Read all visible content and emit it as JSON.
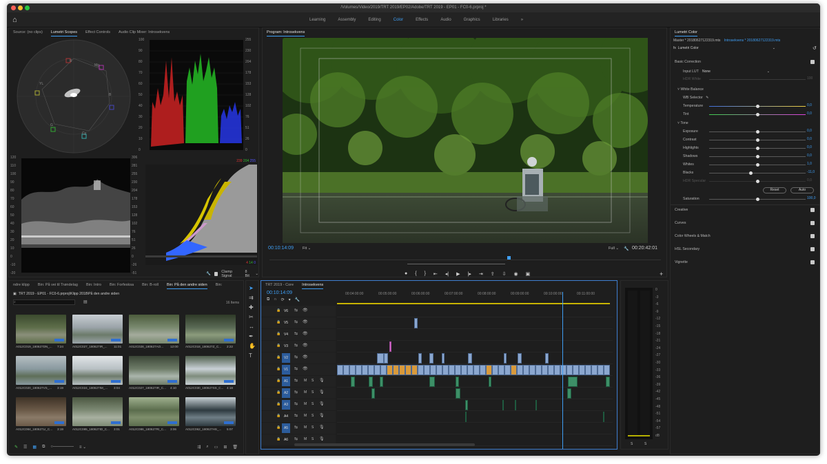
{
  "window": {
    "title": "/Volumes/Video/2019/TRT 2019/EP02/Adobe/TRT 2019 - EP01 - FC0-6.prproj *"
  },
  "workspaces": {
    "tabs": [
      "Learning",
      "Assembly",
      "Editing",
      "Color",
      "Effects",
      "Audio",
      "Graphics",
      "Libraries"
    ],
    "active": "Color",
    "overflow": "»"
  },
  "source_panel": {
    "tabs": [
      "Source: (no clips)",
      "Lumetri Scopes",
      "Effect Controls",
      "Audio Clip Mixer: Introsekvens"
    ],
    "active": "Lumetri Scopes",
    "vectorscope_labels": [
      "R",
      "Mg",
      "B",
      "Cy",
      "G",
      "YL"
    ],
    "parade_scale": [
      "100",
      "90",
      "80",
      "70",
      "60",
      "50",
      "40",
      "30",
      "20",
      "10",
      "0"
    ],
    "parade_scale_right": [
      "255",
      "230",
      "204",
      "178",
      "153",
      "128",
      "102",
      "76",
      "51",
      "26",
      "0"
    ],
    "waveform_scale": [
      "120",
      "110",
      "100",
      "90",
      "80",
      "70",
      "60",
      "50",
      "40",
      "30",
      "20",
      "10",
      "0",
      "-10",
      "-20"
    ],
    "waveform_scale_right": [
      "306",
      "281",
      "255",
      "230",
      "204",
      "178",
      "153",
      "128",
      "102",
      "76",
      "51",
      "26",
      "0",
      "-26",
      "-51"
    ],
    "histogram_header": [
      "239",
      "204",
      "255"
    ],
    "histogram_footer": [
      "4",
      "14",
      "0"
    ],
    "clamp_signal": "Clamp Signal",
    "bit_depth": "8 Bit"
  },
  "program_monitor": {
    "title": "Program: Introsekvens",
    "timecode_current": "00:10:14:09",
    "fit": "Fit",
    "quality": "Full",
    "timecode_total": "00:20:42:01"
  },
  "lumetri_color": {
    "title": "Lumetri Color",
    "master": "Master * 20180627122319.mts",
    "sequence": "Introsekvens * 20180627122319.mts",
    "effect": "Lumetri Color",
    "sections": {
      "basic": "Basic Correction",
      "input_lut_label": "Input LUT",
      "input_lut_value": "None",
      "hdr_white": "HDR White",
      "hdr_white_value": "100",
      "white_balance": "White Balance",
      "wb_selector": "WB Selector",
      "tone": "Tone",
      "reset": "Reset",
      "auto": "Auto",
      "saturation": "Saturation",
      "saturation_value": "100,0",
      "creative": "Creative",
      "curves": "Curves",
      "color_wheels": "Color Wheels & Match",
      "hsl": "HSL Secondary",
      "vignette": "Vignette"
    },
    "wb_rows": [
      {
        "label": "Temperature",
        "value": "0,0",
        "level": 0.5
      },
      {
        "label": "Tint",
        "value": "0,0",
        "level": 0.5
      }
    ],
    "tone_rows": [
      {
        "label": "Exposure",
        "value": "0,0",
        "level": 0.5
      },
      {
        "label": "Contrast",
        "value": "0,0",
        "level": 0.5
      },
      {
        "label": "Highlights",
        "value": "0,0",
        "level": 0.5
      },
      {
        "label": "Shadows",
        "value": "0,0",
        "level": 0.5
      },
      {
        "label": "Whites",
        "value": "1,0",
        "level": 0.5
      },
      {
        "label": "Blacks",
        "value": "-11,0",
        "level": 0.43
      },
      {
        "label": "HDR Specular",
        "value": "0,0",
        "level": 0.5
      }
    ]
  },
  "project_panel": {
    "tabs": [
      "ndre klipp",
      "Bin: På vei til Trøndelag",
      "Bin: Intro",
      "Bin: Forfesksa",
      "Bin: B-roll",
      "Bin: På den andre siden",
      "Bin:"
    ],
    "active": "Bin: På den andre siden",
    "path": "TRT 2019 - EP01 - FC0-6.prproj\\Klipp 2018\\På den andre siden",
    "count": "16 Items",
    "clips": [
      {
        "name": "A012C019_180627DN_...",
        "dur": "7:24"
      },
      {
        "name": "A012C027_180627IR_...",
        "dur": "11:01"
      },
      {
        "name": "A012C028_180627AO...",
        "dur": "12:00"
      },
      {
        "name": "A012C018_180627Z_C...",
        "dur": "2:22"
      },
      {
        "name": "A012C020_180627VS_...",
        "dur": "3:19"
      },
      {
        "name": "A012C024_180627IM_...",
        "dur": "3:04"
      },
      {
        "name": "A012C027_180627IR_C...",
        "dur": "4:10"
      },
      {
        "name": "A012C030_180627SS_C...",
        "dur": "4:18"
      },
      {
        "name": "A012C084_180627LI_C...",
        "dur": "3:19"
      },
      {
        "name": "A012C085_180627ID_C...",
        "dur": "3:01"
      },
      {
        "name": "A012C086_180627RI_C...",
        "dur": "3:06"
      },
      {
        "name": "A012C062_180627HS_...",
        "dur": "5:07"
      }
    ]
  },
  "timeline": {
    "tabs": [
      "TRT 2019 - Core",
      "Introsekvens"
    ],
    "active": "Introsekvens",
    "timecode": "00:10:14:09",
    "ruler": [
      "00:04:00:00",
      "00:05:00:00",
      "00:06:00:00",
      "00:07:00:00",
      "00:08:00:00",
      "00:09:00:00",
      "00:10:00:00",
      "00:11:00:00"
    ],
    "video_tracks": [
      "V6",
      "V5",
      "V4",
      "V3",
      "V2",
      "V1"
    ],
    "audio_tracks": [
      "A1",
      "A2",
      "A3",
      "A4",
      "A5",
      "A6"
    ],
    "mute": "M",
    "solo": "S"
  },
  "meter": {
    "scale": [
      "0",
      "-3",
      "-6",
      "-9",
      "-12",
      "-15",
      "-18",
      "-21",
      "-24",
      "-27",
      "-30",
      "-33",
      "-36",
      "-39",
      "-42",
      "-45",
      "-48",
      "-51",
      "-54",
      "-57",
      "dB"
    ],
    "footer": [
      "S",
      "S"
    ]
  }
}
